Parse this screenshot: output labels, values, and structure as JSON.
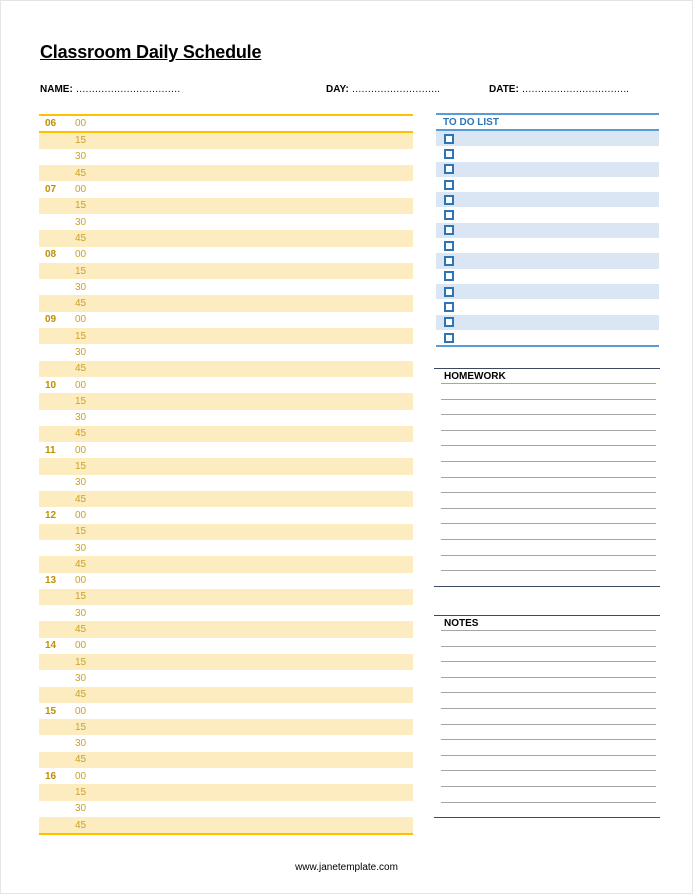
{
  "document": {
    "title": "Classroom Daily Schedule",
    "fields": {
      "name_label": "NAME:",
      "name_dots": "……………………………",
      "day_label": "DAY:",
      "day_dots": "……………………….",
      "date_label": "DATE:",
      "date_dots": "……………………………."
    },
    "schedule": {
      "hours": [
        "06",
        "07",
        "08",
        "09",
        "10",
        "11",
        "12",
        "13",
        "14",
        "15",
        "16"
      ],
      "minutes": [
        "00",
        "15",
        "30",
        "45"
      ]
    },
    "todo": {
      "heading": "TO DO LIST",
      "item_count": 14
    },
    "homework": {
      "heading": "HOMEWORK",
      "line_count": 13
    },
    "notes": {
      "heading": "NOTES",
      "line_count": 12
    },
    "footer": "www.janetemplate.com",
    "colors": {
      "schedule_accent": "#ffc000",
      "schedule_shade": "#fdecc0",
      "schedule_text": "#bf9000",
      "todo_accent": "#5b9bd5",
      "todo_shade": "#dae6f4",
      "todo_text": "#2e75b6",
      "section_rule": "#3b4a5e"
    }
  }
}
